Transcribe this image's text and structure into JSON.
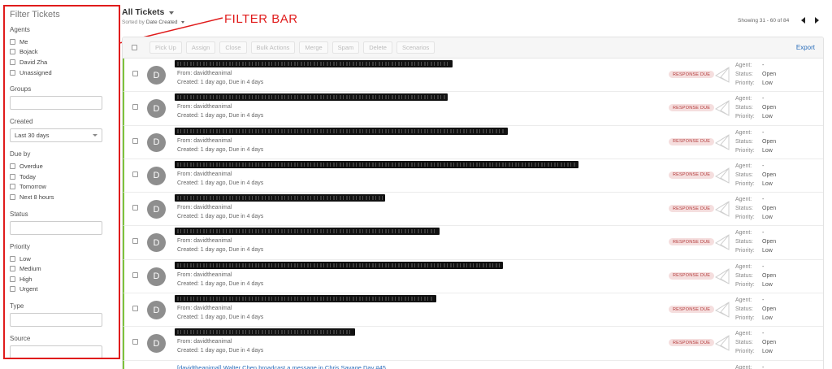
{
  "annotation": {
    "label": "FILTER BAR"
  },
  "sidebar": {
    "title": "Filter Tickets",
    "agents": {
      "label": "Agents",
      "options": [
        "Me",
        "Bojack",
        "David Zha",
        "Unassigned"
      ]
    },
    "groups": {
      "label": "Groups"
    },
    "created": {
      "label": "Created",
      "selected": "Last 30 days"
    },
    "due_by": {
      "label": "Due by",
      "options": [
        "Overdue",
        "Today",
        "Tomorrow",
        "Next 8 hours"
      ]
    },
    "status": {
      "label": "Status"
    },
    "priority": {
      "label": "Priority",
      "options": [
        "Low",
        "Medium",
        "High",
        "Urgent"
      ]
    },
    "type": {
      "label": "Type"
    },
    "source": {
      "label": "Source"
    }
  },
  "header": {
    "title": "All Tickets",
    "sorted_by_label": "Sorted by",
    "sorted_by_value": "Date Created",
    "paging_text": "Showing 31 - 60 of 84"
  },
  "toolbar": {
    "buttons": [
      "Pick Up",
      "Assign",
      "Close",
      "Bulk Actions",
      "Merge",
      "Spam",
      "Delete",
      "Scenarios"
    ],
    "export_label": "Export"
  },
  "tickets": [
    {
      "avatar": "D",
      "from": "From: davidtheanimal",
      "created": "Created: 1 day ago, Due in 4 days",
      "badge": "RESPONSE DUE",
      "agent_label": "Agent:",
      "agent": "-",
      "status_label": "Status:",
      "status": "Open",
      "priority_label": "Priority:",
      "priority": "Low",
      "redacted_width": 342
    },
    {
      "avatar": "D",
      "from": "From: davidtheanimal",
      "created": "Created: 1 day ago, Due in 4 days",
      "badge": "RESPONSE DUE",
      "agent_label": "Agent:",
      "agent": "-",
      "status_label": "Status:",
      "status": "Open",
      "priority_label": "Priority:",
      "priority": "Low",
      "redacted_width": 336
    },
    {
      "avatar": "D",
      "from": "From: davidtheanimal",
      "created": "Created: 1 day ago, Due in 4 days",
      "badge": "RESPONSE DUE",
      "agent_label": "Agent:",
      "agent": "-",
      "status_label": "Status:",
      "status": "Open",
      "priority_label": "Priority:",
      "priority": "Low",
      "redacted_width": 410
    },
    {
      "avatar": "D",
      "from": "From: davidtheanimal",
      "created": "Created: 1 day ago, Due in 4 days",
      "badge": "RESPONSE DUE",
      "agent_label": "Agent:",
      "agent": "-",
      "status_label": "Status:",
      "status": "Open",
      "priority_label": "Priority:",
      "priority": "Low",
      "redacted_width": 497
    },
    {
      "avatar": "D",
      "from": "From: davidtheanimal",
      "created": "Created: 1 day ago, Due in 4 days",
      "badge": "RESPONSE DUE",
      "agent_label": "Agent:",
      "agent": "-",
      "status_label": "Status:",
      "status": "Open",
      "priority_label": "Priority:",
      "priority": "Low",
      "redacted_width": 259
    },
    {
      "avatar": "D",
      "from": "From: davidtheanimal",
      "created": "Created: 1 day ago, Due in 4 days",
      "badge": "RESPONSE DUE",
      "agent_label": "Agent:",
      "agent": "-",
      "status_label": "Status:",
      "status": "Open",
      "priority_label": "Priority:",
      "priority": "Low",
      "redacted_width": 326
    },
    {
      "avatar": "D",
      "from": "From: davidtheanimal",
      "created": "Created: 1 day ago, Due in 4 days",
      "badge": "RESPONSE DUE",
      "agent_label": "Agent:",
      "agent": "-",
      "status_label": "Status:",
      "status": "Open",
      "priority_label": "Priority:",
      "priority": "Low",
      "redacted_width": 404
    },
    {
      "avatar": "D",
      "from": "From: davidtheanimal",
      "created": "Created: 1 day ago, Due in 4 days",
      "badge": "RESPONSE DUE",
      "agent_label": "Agent:",
      "agent": "-",
      "status_label": "Status:",
      "status": "Open",
      "priority_label": "Priority:",
      "priority": "Low",
      "redacted_width": 322
    },
    {
      "avatar": "D",
      "from": "From: davidtheanimal",
      "created": "Created: 1 day ago, Due in 4 days",
      "badge": "RESPONSE DUE",
      "agent_label": "Agent:",
      "agent": "-",
      "status_label": "Status:",
      "status": "Open",
      "priority_label": "Priority:",
      "priority": "Low",
      "redacted_width": 222
    }
  ],
  "last_ticket": {
    "subject": "[davidtheanimal] Walter Chen broadcast a message in Chris Savage Day #45",
    "agent_label": "Agent:",
    "agent": "-"
  },
  "colors": {
    "annotation": "#e01b1b",
    "row_accent": "#7ec23c",
    "link": "#2a6ebb",
    "badge_bg": "#f5dede",
    "badge_text": "#b33a3a"
  }
}
